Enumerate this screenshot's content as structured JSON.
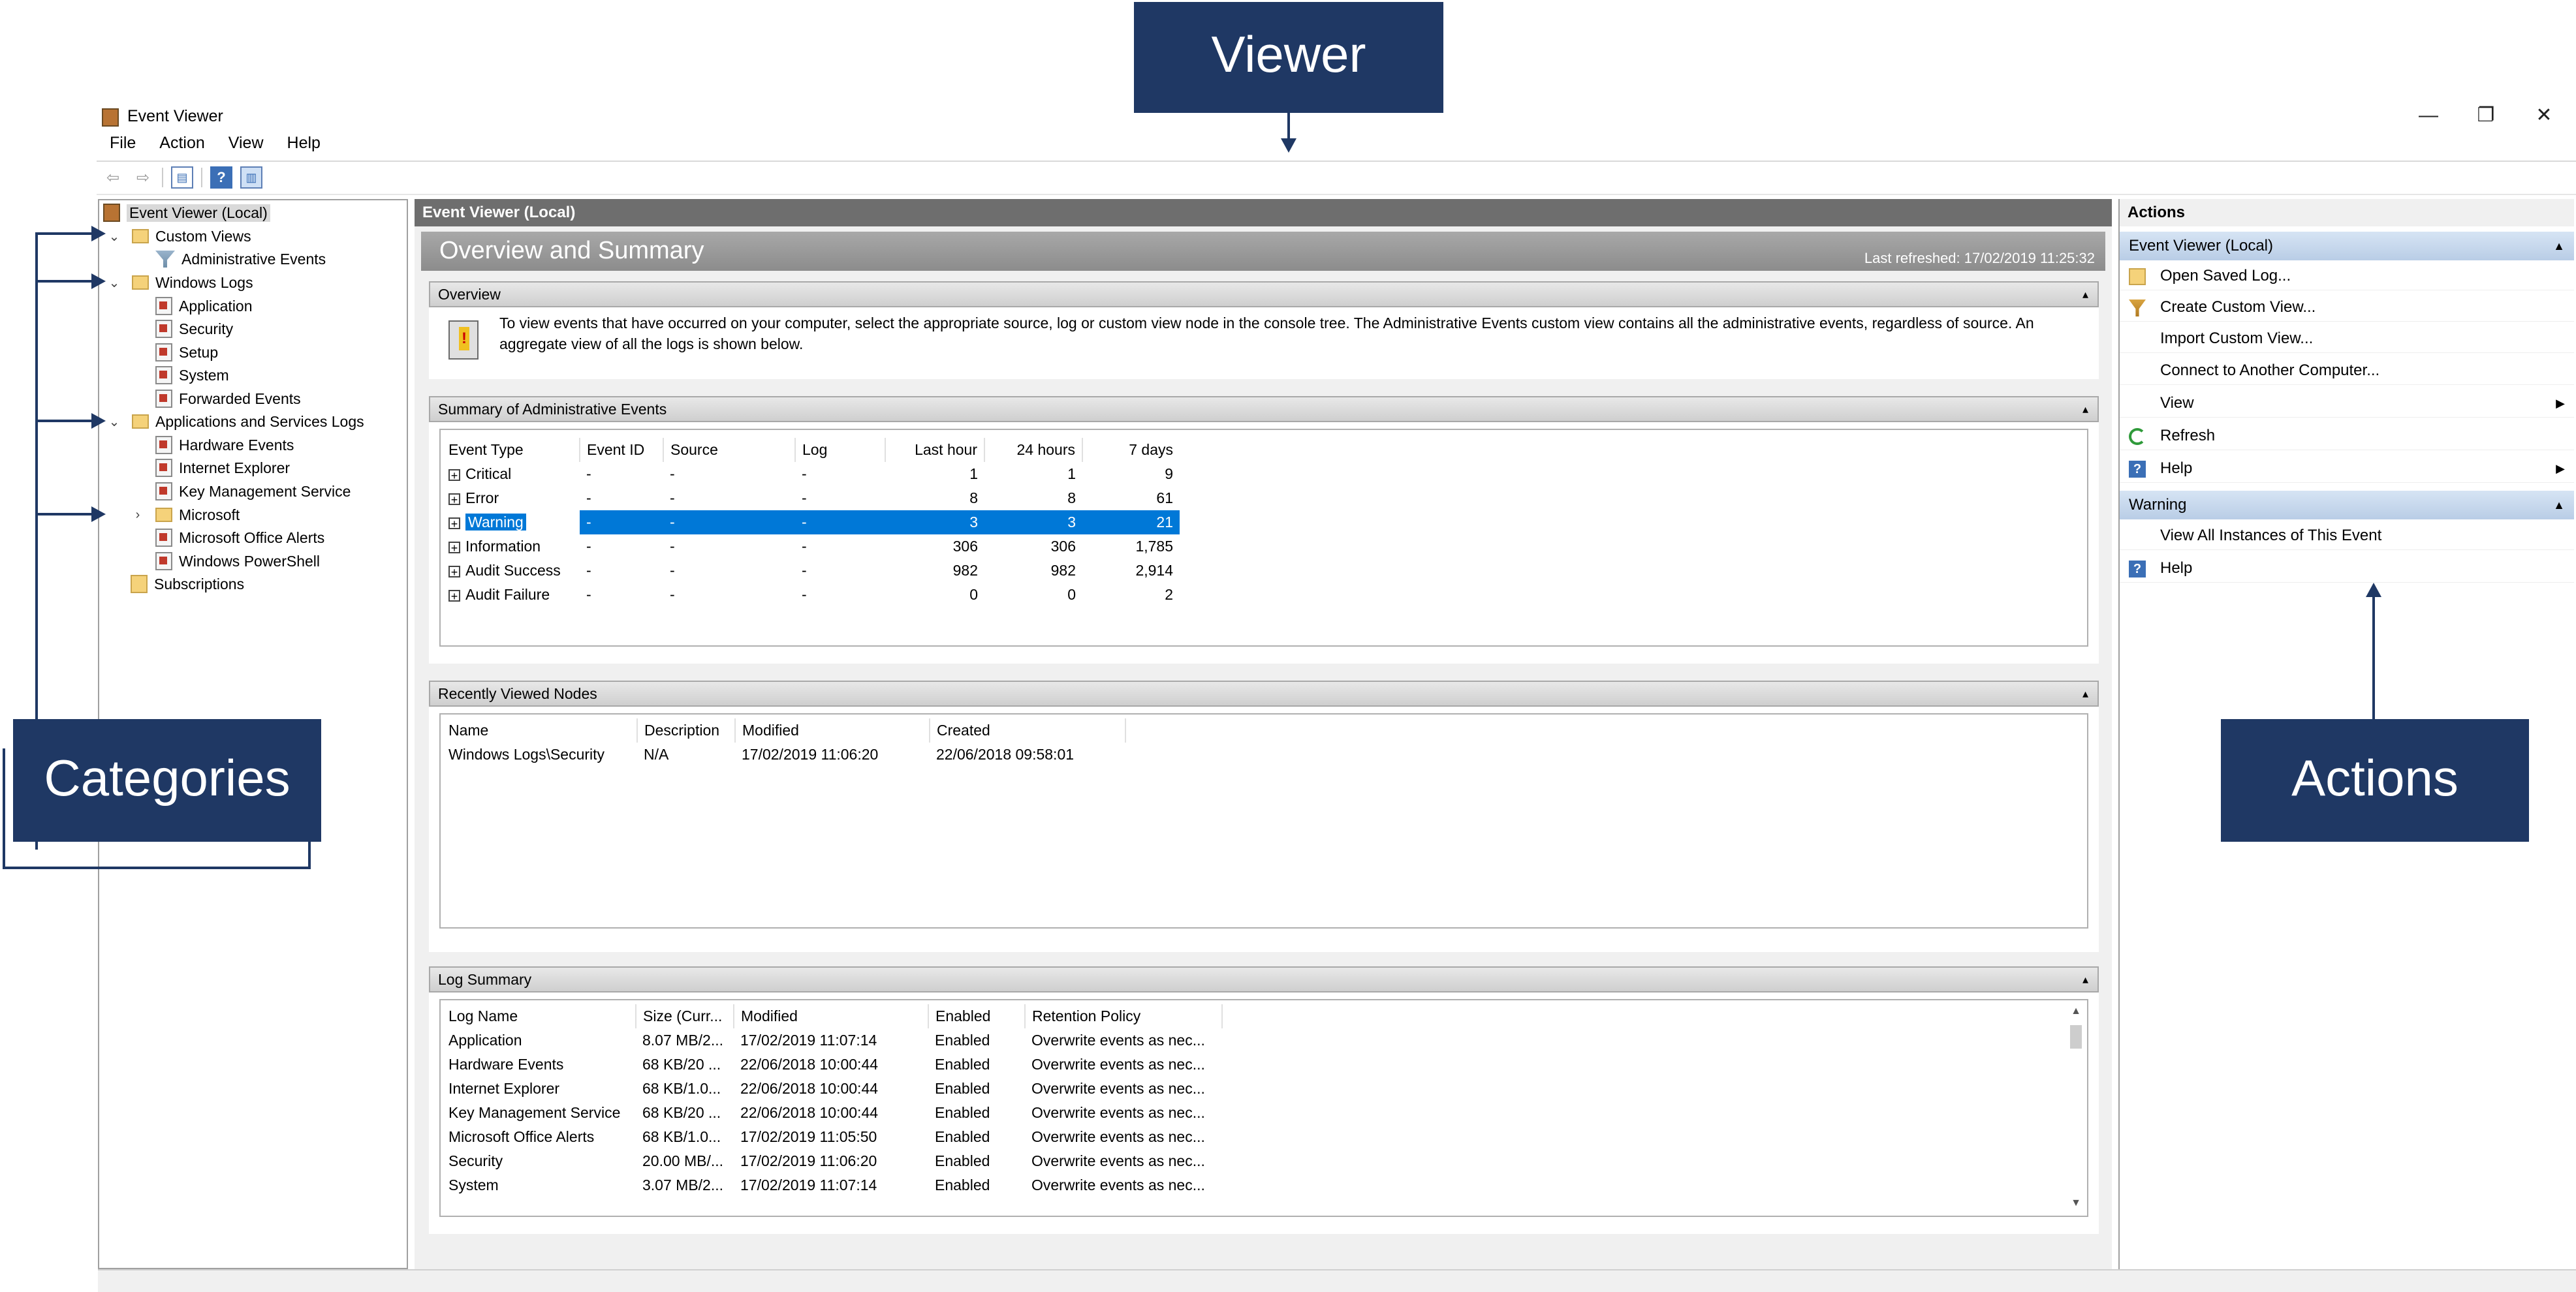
{
  "window": {
    "title": "Event Viewer"
  },
  "window_controls": {
    "minimize": "—",
    "restore": "❐",
    "close": "✕"
  },
  "menu": [
    "File",
    "Action",
    "View",
    "Help"
  ],
  "toolbar": {
    "back": "⇦",
    "forward": "⇨",
    "help": "?"
  },
  "tree": {
    "root": "Event Viewer (Local)",
    "custom_views": "Custom Views",
    "administrative_events": "Administrative Events",
    "windows_logs": "Windows Logs",
    "application": "Application",
    "security": "Security",
    "setup": "Setup",
    "system": "System",
    "forwarded_events": "Forwarded Events",
    "apps_services_logs": "Applications and Services Logs",
    "hardware_events": "Hardware Events",
    "internet_explorer": "Internet Explorer",
    "key_management_service": "Key Management Service",
    "microsoft": "Microsoft",
    "microsoft_office_alerts": "Microsoft Office Alerts",
    "windows_powershell": "Windows PowerShell",
    "subscriptions": "Subscriptions"
  },
  "main": {
    "header": "Event Viewer (Local)",
    "title": "Overview and Summary",
    "last_refreshed": "Last refreshed: 17/02/2019 11:25:32",
    "overview": {
      "heading": "Overview",
      "text": "To view events that have occurred on your computer, select the appropriate source, log or custom view node in the console tree. The Administrative Events custom view contains all the administrative events, regardless of source. An aggregate view of all the logs is shown below."
    },
    "summary": {
      "heading": "Summary of Administrative Events",
      "columns": [
        "Event Type",
        "Event ID",
        "Source",
        "Log",
        "Last hour",
        "24 hours",
        "7 days"
      ],
      "rows": [
        [
          "Critical",
          "-",
          "-",
          "-",
          "1",
          "1",
          "9"
        ],
        [
          "Error",
          "-",
          "-",
          "-",
          "8",
          "8",
          "61"
        ],
        [
          "Warning",
          "-",
          "-",
          "-",
          "3",
          "3",
          "21"
        ],
        [
          "Information",
          "-",
          "-",
          "-",
          "306",
          "306",
          "1,785"
        ],
        [
          "Audit Success",
          "-",
          "-",
          "-",
          "982",
          "982",
          "2,914"
        ],
        [
          "Audit Failure",
          "-",
          "-",
          "-",
          "0",
          "0",
          "2"
        ]
      ]
    },
    "recent": {
      "heading": "Recently Viewed Nodes",
      "columns": [
        "Name",
        "Description",
        "Modified",
        "Created"
      ],
      "rows": [
        [
          "Windows Logs\\Security",
          "N/A",
          "17/02/2019 11:06:20",
          "22/06/2018 09:58:01"
        ]
      ]
    },
    "log_summary": {
      "heading": "Log Summary",
      "columns": [
        "Log Name",
        "Size (Curr...",
        "Modified",
        "Enabled",
        "Retention Policy"
      ],
      "rows": [
        [
          "Application",
          "8.07 MB/2...",
          "17/02/2019 11:07:14",
          "Enabled",
          "Overwrite events as nec..."
        ],
        [
          "Hardware Events",
          "68 KB/20 ...",
          "22/06/2018 10:00:44",
          "Enabled",
          "Overwrite events as nec..."
        ],
        [
          "Internet Explorer",
          "68 KB/1.0...",
          "22/06/2018 10:00:44",
          "Enabled",
          "Overwrite events as nec..."
        ],
        [
          "Key Management Service",
          "68 KB/20 ...",
          "22/06/2018 10:00:44",
          "Enabled",
          "Overwrite events as nec..."
        ],
        [
          "Microsoft Office Alerts",
          "68 KB/1.0...",
          "17/02/2019 11:05:50",
          "Enabled",
          "Overwrite events as nec..."
        ],
        [
          "Security",
          "20.00 MB/...",
          "17/02/2019 11:06:20",
          "Enabled",
          "Overwrite events as nec..."
        ],
        [
          "System",
          "3.07 MB/2...",
          "17/02/2019 11:07:14",
          "Enabled",
          "Overwrite events as nec..."
        ]
      ]
    }
  },
  "actions": {
    "header": "Actions",
    "group1": "Event Viewer (Local)",
    "items1": [
      "Open Saved Log...",
      "Create Custom View...",
      "Import Custom View...",
      "Connect to Another Computer...",
      "View",
      "Refresh",
      "Help"
    ],
    "group2": "Warning",
    "items2": [
      "View All Instances of This Event",
      "Help"
    ]
  },
  "callouts": {
    "viewer": "Viewer",
    "categories": "Categories",
    "actions": "Actions"
  },
  "icons": {
    "app": "event-viewer-icon",
    "log": "log-icon",
    "folder": "folder-icon",
    "filter": "filter-icon",
    "refresh": "refresh-icon",
    "help": "help-icon"
  },
  "colors": {
    "selection": "#0078d7",
    "callout": "#1f3864",
    "header_gray": "#6e6e6e",
    "action_group": "#c6d7ed"
  }
}
